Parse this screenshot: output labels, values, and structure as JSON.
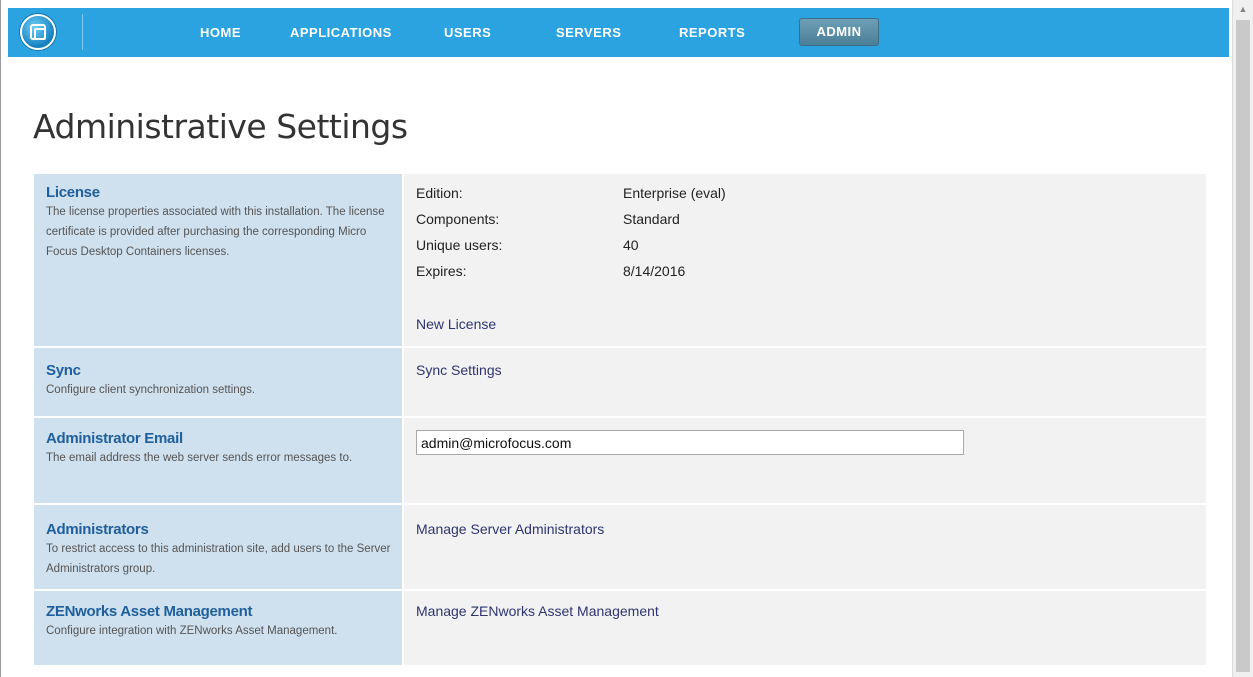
{
  "nav": {
    "items": [
      {
        "label": "HOME"
      },
      {
        "label": "APPLICATIONS"
      },
      {
        "label": "USERS"
      },
      {
        "label": "SERVERS"
      },
      {
        "label": "REPORTS"
      }
    ],
    "active": "ADMIN"
  },
  "page": {
    "title": "Administrative Settings"
  },
  "sections": {
    "license": {
      "title": "License",
      "description": "The license properties associated with this installation. The license certificate is provided after purchasing the corresponding Micro Focus Desktop Containers licenses.",
      "fields": [
        {
          "label": "Edition:",
          "value": "Enterprise (eval)"
        },
        {
          "label": "Components:",
          "value": "Standard"
        },
        {
          "label": "Unique users:",
          "value": "40"
        },
        {
          "label": "Expires:",
          "value": "8/14/2016"
        }
      ],
      "link": "New License"
    },
    "sync": {
      "title": "Sync",
      "description": "Configure client synchronization settings.",
      "link": "Sync Settings"
    },
    "email": {
      "title": "Administrator Email",
      "description": "The email address the web server sends error messages to.",
      "value": "admin@microfocus.com"
    },
    "administrators": {
      "title": "Administrators",
      "description": "To restrict access to this administration site, add users to the Server Administrators group.",
      "link": "Manage Server Administrators"
    },
    "zenworks": {
      "title": "ZENworks Asset Management",
      "description": "Configure integration with ZENworks Asset Management.",
      "link": "Manage ZENworks Asset Management"
    }
  }
}
